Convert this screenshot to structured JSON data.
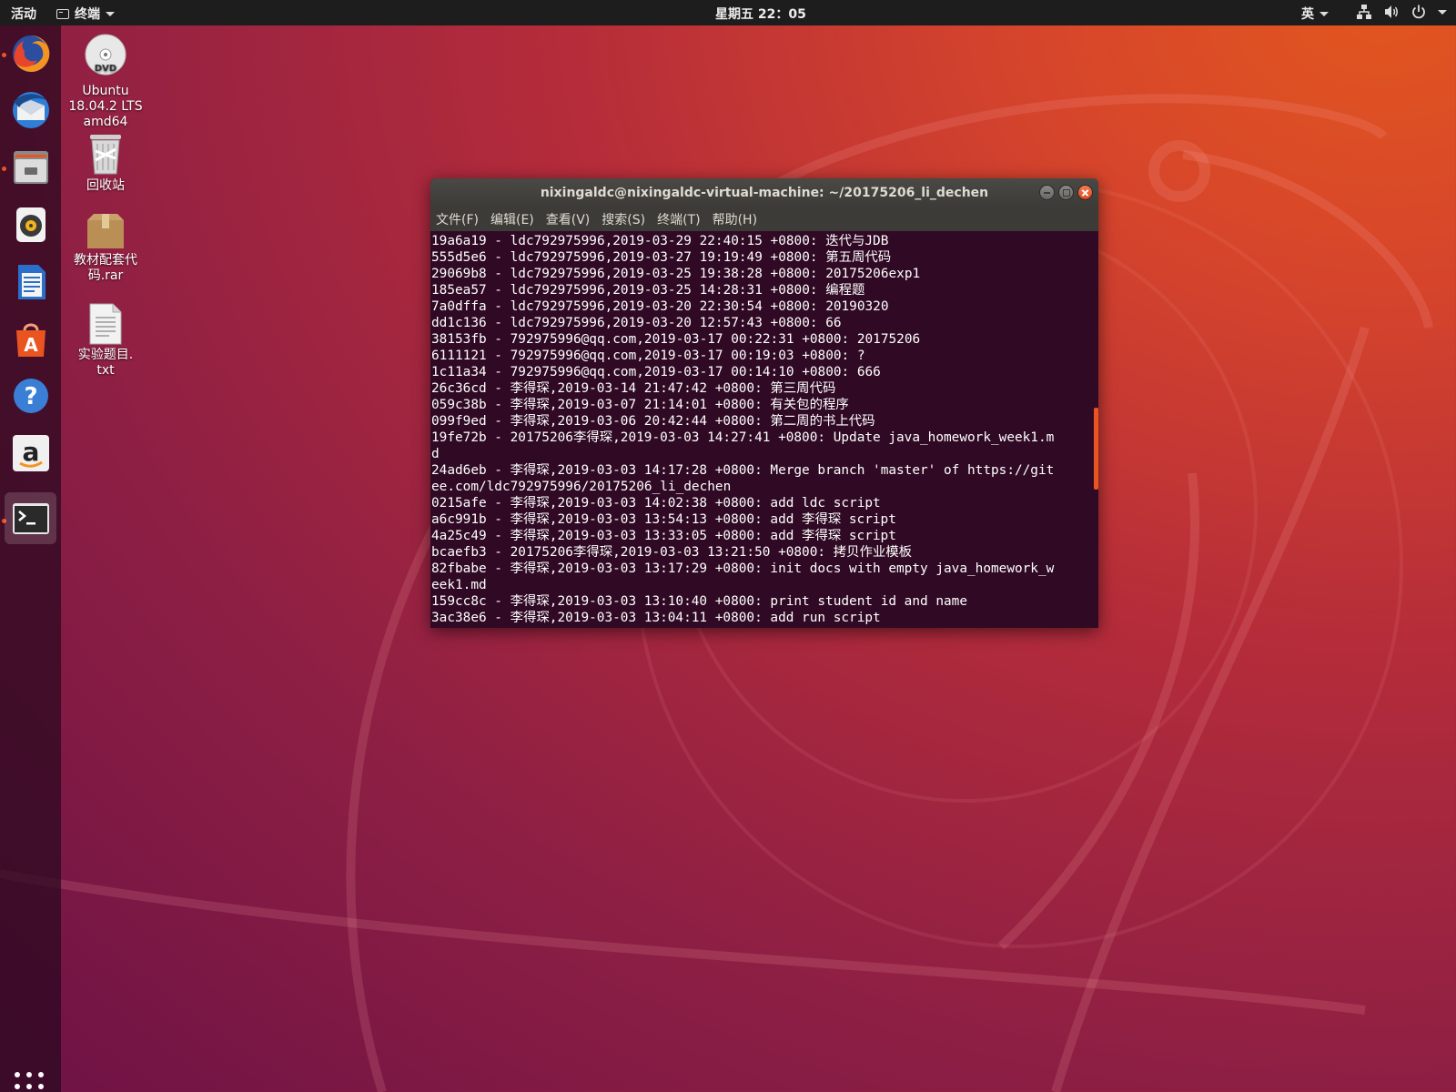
{
  "topbar": {
    "activities": "活动",
    "app_menu": "终端",
    "clock": "星期五 22：05",
    "input_method": "英"
  },
  "dock": {
    "items": [
      {
        "name": "firefox",
        "running": true
      },
      {
        "name": "thunderbird",
        "running": false
      },
      {
        "name": "files",
        "running": true
      },
      {
        "name": "rhythmbox",
        "running": false
      },
      {
        "name": "libreoffice-writer",
        "running": false
      },
      {
        "name": "ubuntu-software",
        "running": false
      },
      {
        "name": "help",
        "running": false
      },
      {
        "name": "amazon",
        "running": false
      },
      {
        "name": "terminal",
        "running": true
      }
    ]
  },
  "desktop": {
    "icons": [
      {
        "label": "Ubuntu\n18.04.2 LTS\namd64",
        "icon": "dvd-icon"
      },
      {
        "label": "回收站",
        "icon": "trash-icon"
      },
      {
        "label": "教材配套代\n码.rar",
        "icon": "archive-icon"
      },
      {
        "label": "实验题目.\ntxt",
        "icon": "text-file-icon"
      }
    ]
  },
  "terminal": {
    "title": "nixingaldc@nixingaldc-virtual-machine: ~/20175206_li_dechen",
    "menu": [
      "文件(F)",
      "编辑(E)",
      "查看(V)",
      "搜索(S)",
      "终端(T)",
      "帮助(H)"
    ],
    "lines": [
      "19a6a19 - ldc792975996,2019-03-29 22:40:15 +0800: 迭代与JDB",
      "555d5e6 - ldc792975996,2019-03-27 19:19:49 +0800: 第五周代码",
      "29069b8 - ldc792975996,2019-03-25 19:38:28 +0800: 20175206exp1",
      "185ea57 - ldc792975996,2019-03-25 14:28:31 +0800: 编程题",
      "7a0dffa - ldc792975996,2019-03-20 22:30:54 +0800: 20190320",
      "dd1c136 - ldc792975996,2019-03-20 12:57:43 +0800: 66",
      "38153fb - 792975996@qq.com,2019-03-17 00:22:31 +0800: 20175206",
      "6111121 - 792975996@qq.com,2019-03-17 00:19:03 +0800: ?",
      "1c11a34 - 792975996@qq.com,2019-03-17 00:14:10 +0800: 666",
      "26c36cd - 李得琛,2019-03-14 21:47:42 +0800: 第三周代码",
      "059c38b - 李得琛,2019-03-07 21:14:01 +0800: 有关包的程序",
      "099f9ed - 李得琛,2019-03-06 20:42:44 +0800: 第二周的书上代码",
      "19fe72b - 20175206李得琛,2019-03-03 14:27:41 +0800: Update java_homework_week1.m",
      "d",
      "24ad6eb - 李得琛,2019-03-03 14:17:28 +0800: Merge branch 'master' of https://git",
      "ee.com/ldc792975996/20175206_li_dechen",
      "0215afe - 李得琛,2019-03-03 14:02:38 +0800: add ldc script",
      "a6c991b - 李得琛,2019-03-03 13:54:13 +0800: add 李得琛 script",
      "4a25c49 - 李得琛,2019-03-03 13:33:05 +0800: add 李得琛 script",
      "bcaefb3 - 20175206李得琛,2019-03-03 13:21:50 +0800: 拷贝作业模板",
      "82fbabe - 李得琛,2019-03-03 13:17:29 +0800: init docs with empty java_homework_w",
      "eek1.md",
      "159cc8c - 李得琛,2019-03-03 13:10:40 +0800: print student id and name",
      "3ac38e6 - 李得琛,2019-03-03 13:04:11 +0800: add run script"
    ]
  },
  "colors": {
    "accent": "#e95420",
    "terminal_bg": "#300a24",
    "titlebar": "#3c3b37"
  }
}
